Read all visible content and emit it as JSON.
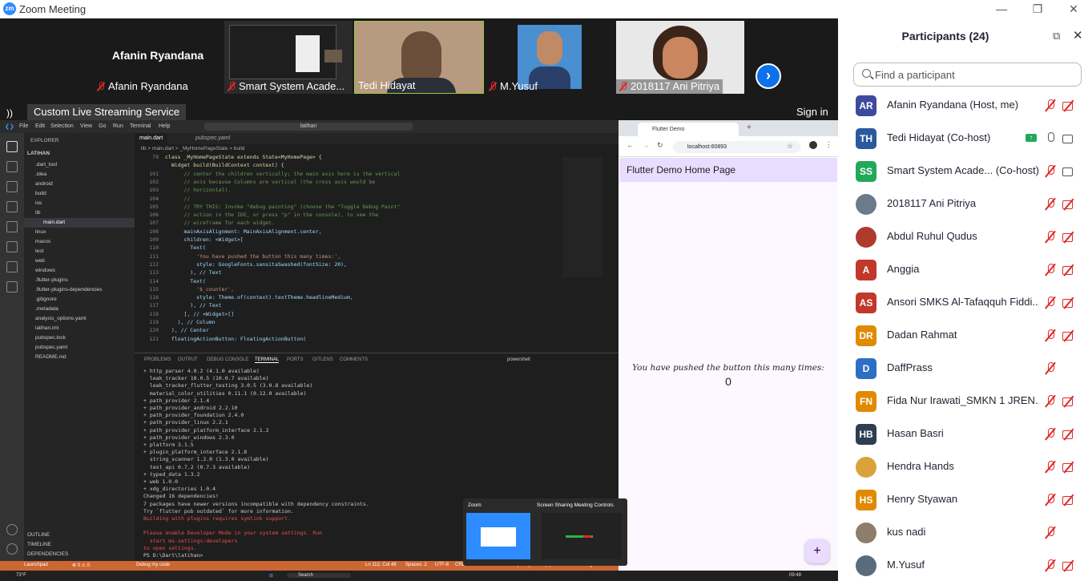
{
  "window": {
    "title": "Zoom Meeting",
    "logo": "zm"
  },
  "gallery": {
    "tiles": [
      {
        "name": "Afanin Ryandana",
        "big_label": "Afanin Ryandana",
        "muted": true
      },
      {
        "name": "Smart System Acade...",
        "muted": true
      },
      {
        "name": "Tedi Hidayat",
        "muted": false
      },
      {
        "name": "M.Yusuf",
        "muted": true
      },
      {
        "name": "2018117 Ani Pitriya",
        "muted": true
      }
    ],
    "next_icon": "chevron-right-icon"
  },
  "livebar": {
    "label": "Custom Live Streaming Service",
    "signin": "Sign in"
  },
  "vscode": {
    "menu": [
      "File",
      "Edit",
      "Selection",
      "View",
      "Go",
      "Run",
      "Terminal",
      "Help"
    ],
    "search": "latihan",
    "sidebar_title": "EXPLORER",
    "project": "LATIHAN",
    "tree": [
      ".dart_tool",
      ".idea",
      "android",
      "build",
      "ios",
      "lib",
      "main.dart",
      "linux",
      "macos",
      "test",
      "web",
      "windows",
      ".flutter-plugins",
      ".flutter-plugins-dependencies",
      ".gitignore",
      ".metadata",
      "analysis_options.yaml",
      "latihan.iml",
      "pubspec.lock",
      "pubspec.yaml",
      "README.md"
    ],
    "outline": [
      "OUTLINE",
      "TIMELINE",
      "DEPENDENCIES"
    ],
    "tabs": [
      "main.dart",
      "pubspec.yaml"
    ],
    "breadcrumb": "lib > main.dart > _MyHomePageState > build",
    "code": [
      {
        "n": "79",
        "t": "class _MyHomePageState extends State<MyHomePage> {"
      },
      {
        "n": "",
        "t": "  Widget build(BuildContext context) {"
      },
      {
        "n": "101",
        "t": "      // center the children vertically; the main axis here is the vertical"
      },
      {
        "n": "102",
        "t": "      // axis because Columns are vertical (the cross axis would be"
      },
      {
        "n": "103",
        "t": "      // horizontal)."
      },
      {
        "n": "104",
        "t": "      //"
      },
      {
        "n": "105",
        "t": "      // TRY THIS: Invoke \"debug painting\" (choose the \"Toggle Debug Paint\""
      },
      {
        "n": "106",
        "t": "      // action in the IDE, or press \"p\" in the console), to see the"
      },
      {
        "n": "107",
        "t": "      // wireframe for each widget."
      },
      {
        "n": "108",
        "t": "      mainAxisAlignment: MainAxisAlignment.center,"
      },
      {
        "n": "109",
        "t": "      children: <Widget>["
      },
      {
        "n": "110",
        "t": "        Text("
      },
      {
        "n": "111",
        "t": "          'You have pushed the button this many times:',"
      },
      {
        "n": "112",
        "t": "          style: GoogleFonts.sansitaSwashed(fontSize: 20),"
      },
      {
        "n": "113",
        "t": "        ), // Text"
      },
      {
        "n": "114",
        "t": "        Text("
      },
      {
        "n": "115",
        "t": "          '$_counter',"
      },
      {
        "n": "116",
        "t": "          style: Theme.of(context).textTheme.headlineMedium,"
      },
      {
        "n": "117",
        "t": "        ), // Text"
      },
      {
        "n": "118",
        "t": "      ], // <Widget>[]"
      },
      {
        "n": "119",
        "t": "    ), // Column"
      },
      {
        "n": "120",
        "t": "  ), // Center"
      },
      {
        "n": "121",
        "t": "  floatingActionButton: FloatingActionButton("
      }
    ],
    "panel_tabs": [
      "PROBLEMS",
      "OUTPUT",
      "DEBUG CONSOLE",
      "TERMINAL",
      "PORTS",
      "GITLENS",
      "COMMENTS"
    ],
    "shell": "powershell",
    "terminal": [
      {
        "t": "+ http_parser 4.0.2 (4.1.0 available)",
        "c": "#ccc"
      },
      {
        "t": "  leak_tracker 10.0.5 (10.0.7 available)",
        "c": "#ccc"
      },
      {
        "t": "  leak_tracker_flutter_testing 3.0.5 (3.0.8 available)",
        "c": "#ccc"
      },
      {
        "t": "  material_color_utilities 0.11.1 (0.12.0 available)",
        "c": "#ccc"
      },
      {
        "t": "+ path_provider 2.1.4",
        "c": "#ccc"
      },
      {
        "t": "+ path_provider_android 2.2.10",
        "c": "#ccc"
      },
      {
        "t": "+ path_provider_foundation 2.4.0",
        "c": "#ccc"
      },
      {
        "t": "+ path_provider_linux 2.2.1",
        "c": "#ccc"
      },
      {
        "t": "+ path_provider_platform_interface 2.1.2",
        "c": "#ccc"
      },
      {
        "t": "+ path_provider_windows 2.3.0",
        "c": "#ccc"
      },
      {
        "t": "+ platform 3.1.5",
        "c": "#ccc"
      },
      {
        "t": "+ plugin_platform_interface 2.1.8",
        "c": "#ccc"
      },
      {
        "t": "  string_scanner 1.2.0 (1.3.0 available)",
        "c": "#ccc"
      },
      {
        "t": "  test_api 0.7.2 (0.7.3 available)",
        "c": "#ccc"
      },
      {
        "t": "+ typed_data 1.3.2",
        "c": "#ccc"
      },
      {
        "t": "+ web 1.0.0",
        "c": "#ccc"
      },
      {
        "t": "+ xdg_directories 1.0.4",
        "c": "#ccc"
      },
      {
        "t": "Changed 16 dependencies!",
        "c": "#ccc"
      },
      {
        "t": "7 packages have newer versions incompatible with dependency constraints.",
        "c": "#ccc"
      },
      {
        "t": "Try `flutter pub outdated` for more information.",
        "c": "#ccc"
      },
      {
        "t": "Building with plugins requires symlink support.",
        "c": "#f14c4c"
      },
      {
        "t": "",
        "c": "#ccc"
      },
      {
        "t": "Please enable Developer Mode in your system settings. Run",
        "c": "#f14c4c"
      },
      {
        "t": "  start ms-settings:developers",
        "c": "#f14c4c"
      },
      {
        "t": "to open settings.",
        "c": "#f14c4c"
      },
      {
        "t": "PS D:\\Dart\\latihan> ",
        "c": "#ccc"
      }
    ],
    "status": {
      "launchpad": "Launchpad",
      "counts": "⊗ 0 ⚠ 0",
      "mode": "Debug my code",
      "pos": "Ln 112, Col 48",
      "spaces": "Spaces: 2",
      "enc": "UTF-8",
      "eol": "CRLF",
      "lang": "Dart",
      "device": "Chrome (web-javascript)",
      "login": "Codeium: Login"
    }
  },
  "chrome": {
    "tab_title": "Flutter Demo",
    "url": "localhost:60893",
    "app_bar": "Flutter Demo Home Page",
    "message": "You have pushed the button this many times:",
    "counter": "0",
    "fab": "+"
  },
  "thumbs": {
    "a": "Zoom",
    "b": "Screen Sharing Meeting Controls"
  },
  "taskbar": {
    "temp": "73°F",
    "search": "Search",
    "time": "09:48"
  },
  "participants": {
    "title": "Participants (24)",
    "search_placeholder": "Find a participant",
    "list": [
      {
        "initials": "AR",
        "color": "#3e4a9e",
        "name": "Afanin Ryandana (Host, me)",
        "mic": "off",
        "cam": "off"
      },
      {
        "initials": "TH",
        "color": "#2a5a9e",
        "name": "Tedi Hidayat (Co-host)",
        "mic": "on",
        "cam": "on",
        "share": true
      },
      {
        "initials": "SS",
        "color": "#23a85a",
        "name": "Smart System Acade...  (Co-host)",
        "mic": "off",
        "cam": "on"
      },
      {
        "initials": "",
        "color": "#6b7b8c",
        "name": "2018117 Ani Pitriya",
        "mic": "off",
        "cam": "off",
        "photo": true
      },
      {
        "initials": "",
        "color": "#b03a2e",
        "name": "Abdul Ruhul Qudus",
        "mic": "off",
        "cam": "off",
        "photo": true
      },
      {
        "initials": "A",
        "color": "#c0392b",
        "name": "Anggia",
        "mic": "off",
        "cam": "off"
      },
      {
        "initials": "AS",
        "color": "#c0392b",
        "name": "Ansori SMKS Al-Tafaqquh Fiddi...",
        "mic": "off",
        "cam": "off"
      },
      {
        "initials": "DR",
        "color": "#e08a00",
        "name": "Dadan Rahmat",
        "mic": "off",
        "cam": "off"
      },
      {
        "initials": "D",
        "color": "#2d6fc4",
        "name": "DaffPrass",
        "mic": "off",
        "cam": "none"
      },
      {
        "initials": "FN",
        "color": "#e08a00",
        "name": "Fida Nur Irawati_SMKN 1 JREN...",
        "mic": "off",
        "cam": "off"
      },
      {
        "initials": "HB",
        "color": "#2c3e50",
        "name": "Hasan Basri",
        "mic": "off",
        "cam": "off"
      },
      {
        "initials": "",
        "color": "#d9a23a",
        "name": "Hendra Hands",
        "mic": "off",
        "cam": "off",
        "photo": true
      },
      {
        "initials": "HS",
        "color": "#e08a00",
        "name": "Henry Styawan",
        "mic": "off",
        "cam": "off"
      },
      {
        "initials": "",
        "color": "#8e7d6a",
        "name": "kus nadi",
        "mic": "off",
        "cam": "none",
        "photo": true
      },
      {
        "initials": "",
        "color": "#5a6b7c",
        "name": "M.Yusuf",
        "mic": "off",
        "cam": "off",
        "photo": true
      }
    ]
  }
}
